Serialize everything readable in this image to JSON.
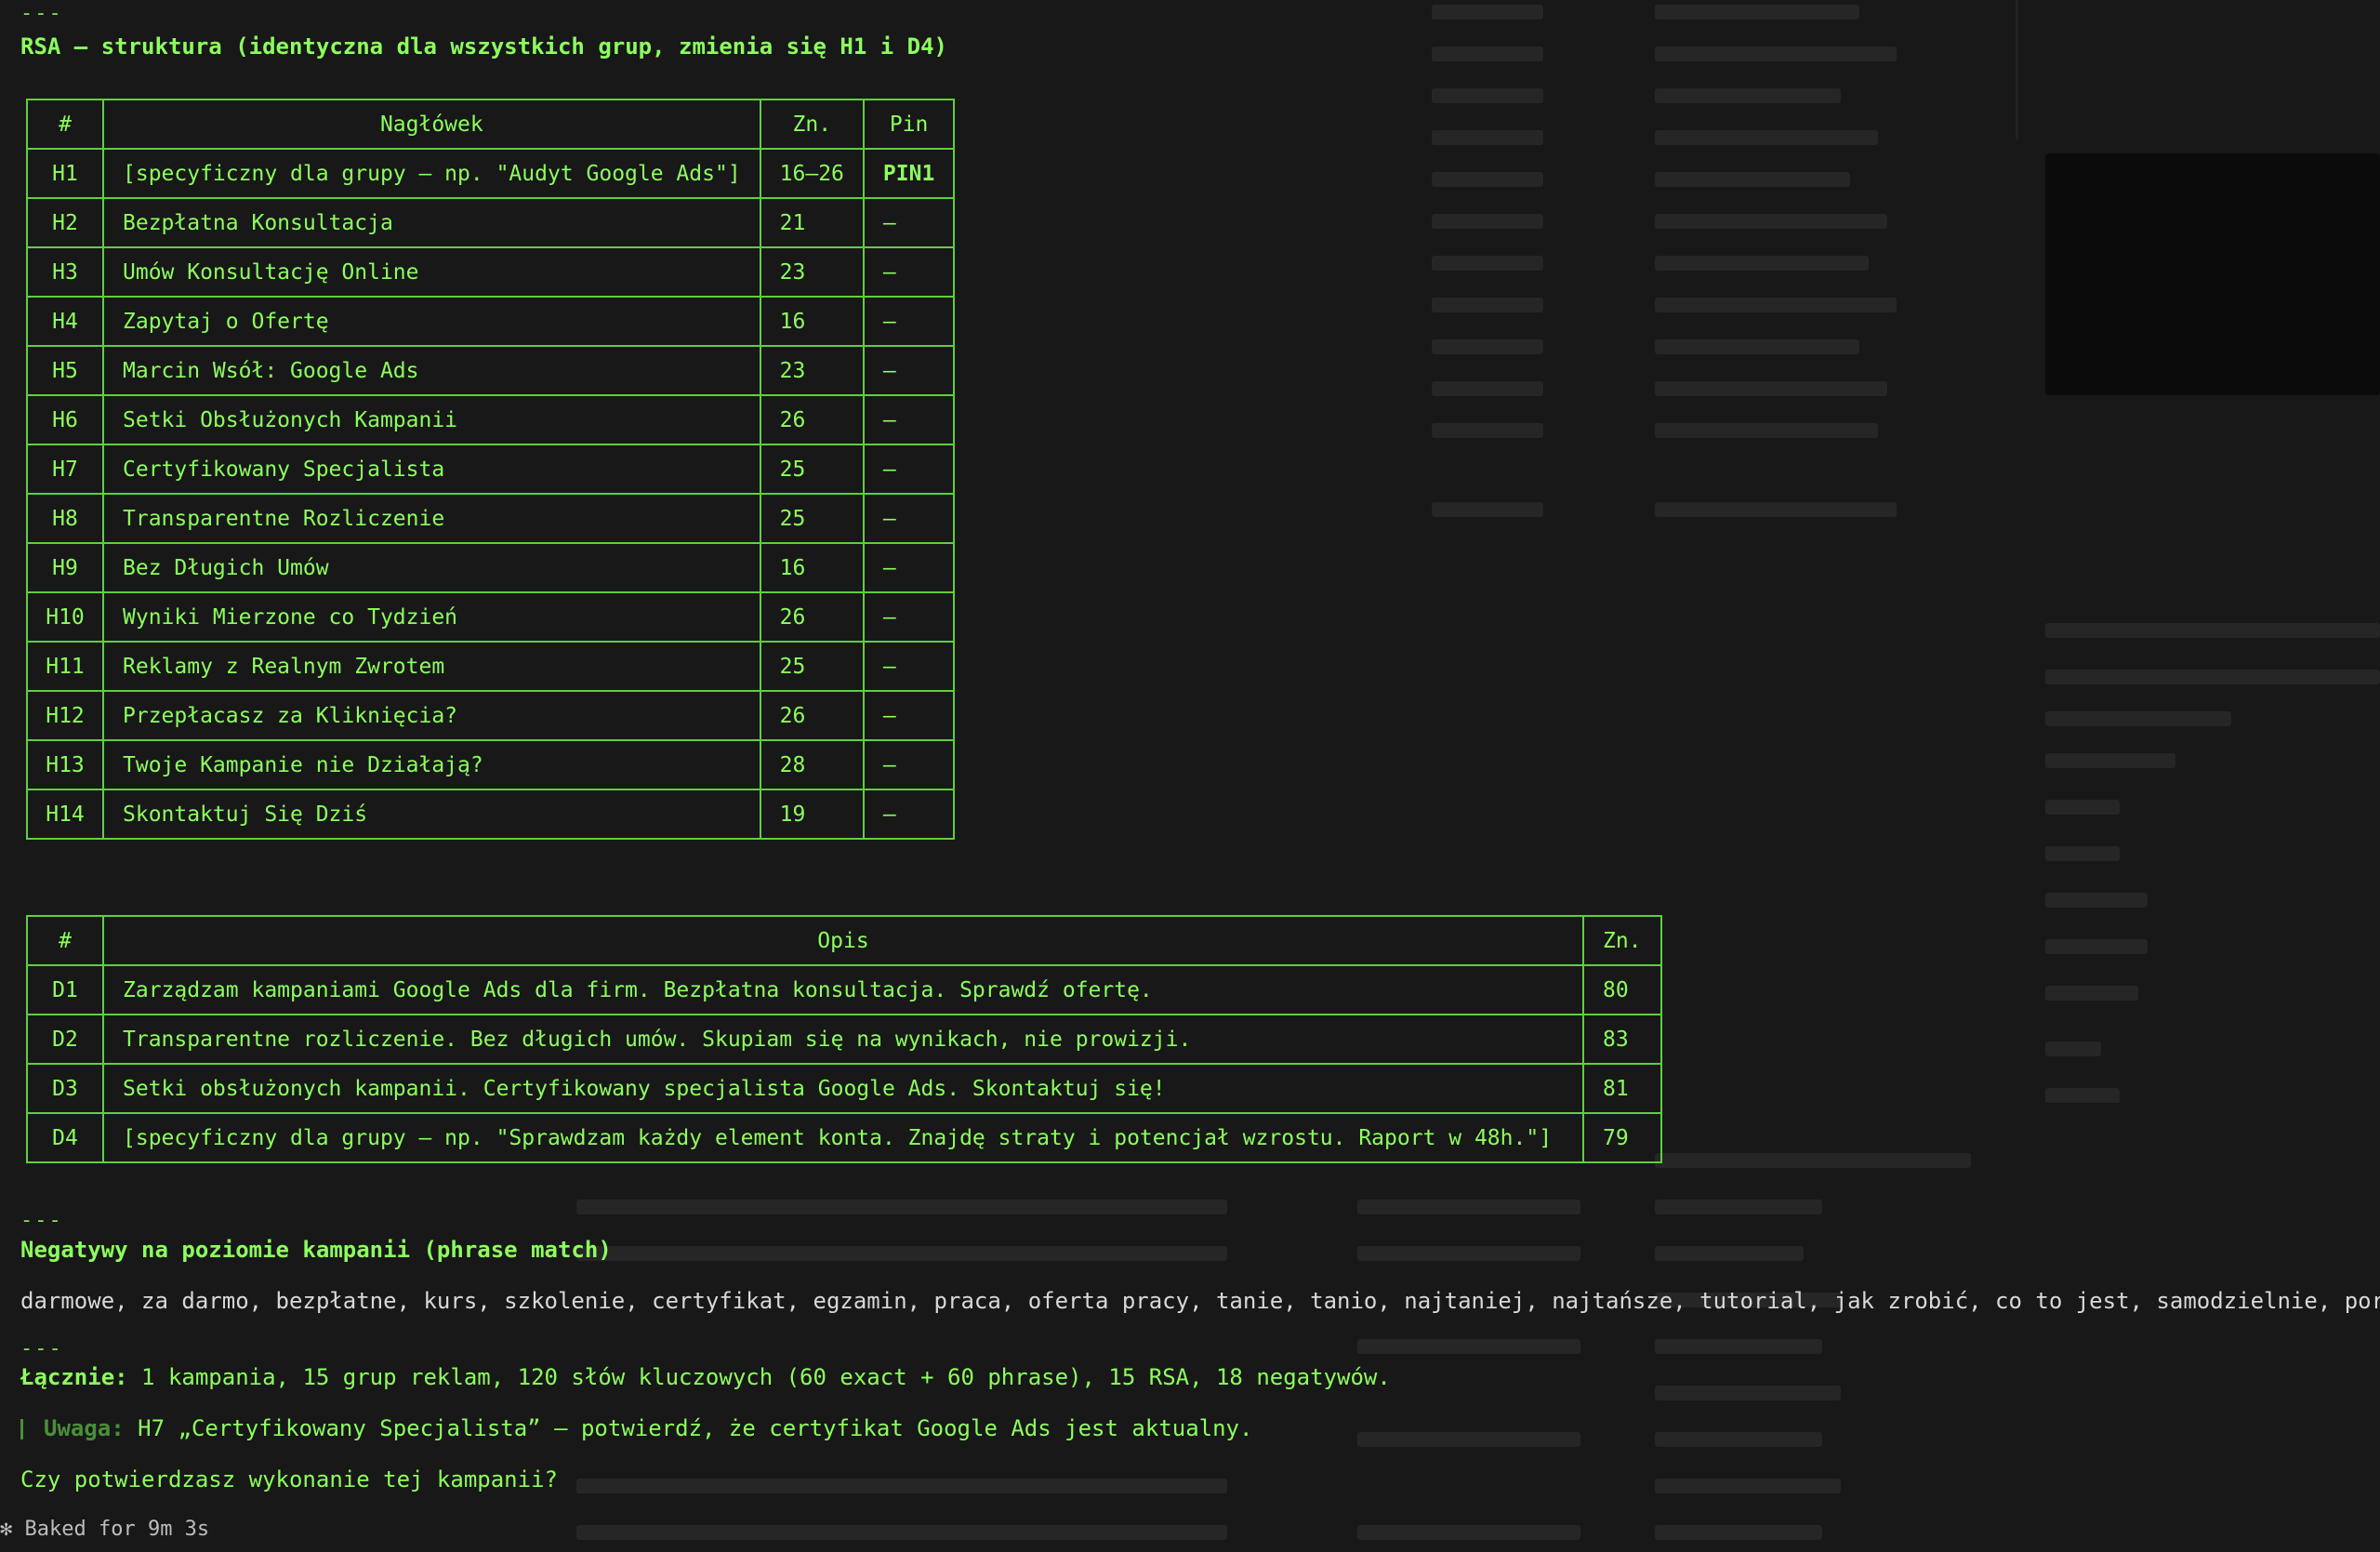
{
  "top_separator": "---",
  "rsa_title": "RSA — struktura (identyczna dla wszystkich grup, zmienia się H1 i D4)",
  "headlines_table": {
    "columns": [
      "#",
      "Nagłówek",
      "Zn.",
      "Pin"
    ],
    "rows": [
      {
        "id": "H1",
        "text": "[specyficzny dla grupy — np. \"Audyt Google Ads\"]",
        "chars": "16–26",
        "pin": "PIN1"
      },
      {
        "id": "H2",
        "text": "Bezpłatna Konsultacja",
        "chars": "21",
        "pin": "—"
      },
      {
        "id": "H3",
        "text": "Umów Konsultację Online",
        "chars": "23",
        "pin": "—"
      },
      {
        "id": "H4",
        "text": "Zapytaj o Ofertę",
        "chars": "16",
        "pin": "—"
      },
      {
        "id": "H5",
        "text": "Marcin Wsół: Google Ads",
        "chars": "23",
        "pin": "—"
      },
      {
        "id": "H6",
        "text": "Setki Obsłużonych Kampanii",
        "chars": "26",
        "pin": "—"
      },
      {
        "id": "H7",
        "text": "Certyfikowany Specjalista",
        "chars": "25",
        "pin": "—"
      },
      {
        "id": "H8",
        "text": "Transparentne Rozliczenie",
        "chars": "25",
        "pin": "—"
      },
      {
        "id": "H9",
        "text": "Bez Długich Umów",
        "chars": "16",
        "pin": "—"
      },
      {
        "id": "H10",
        "text": "Wyniki Mierzone co Tydzień",
        "chars": "26",
        "pin": "—"
      },
      {
        "id": "H11",
        "text": "Reklamy z Realnym Zwrotem",
        "chars": "25",
        "pin": "—"
      },
      {
        "id": "H12",
        "text": "Przepłacasz za Kliknięcia?",
        "chars": "26",
        "pin": "—"
      },
      {
        "id": "H13",
        "text": "Twoje Kampanie nie Działają?",
        "chars": "28",
        "pin": "—"
      },
      {
        "id": "H14",
        "text": "Skontaktuj Się Dziś",
        "chars": "19",
        "pin": "—"
      }
    ]
  },
  "descriptions_table": {
    "columns": [
      "#",
      "Opis",
      "Zn."
    ],
    "rows": [
      {
        "id": "D1",
        "text": "Zarządzam kampaniami Google Ads dla firm. Bezpłatna konsultacja. Sprawdź ofertę.",
        "chars": "80"
      },
      {
        "id": "D2",
        "text": "Transparentne rozliczenie. Bez długich umów. Skupiam się na wynikach, nie prowizji.",
        "chars": "83"
      },
      {
        "id": "D3",
        "text": "Setki obsłużonych kampanii. Certyfikowany specjalista Google Ads. Skontaktuj się!",
        "chars": "81"
      },
      {
        "id": "D4",
        "text": "[specyficzny dla grupy — np. \"Sprawdzam każdy element konta. Znajdę straty i potencjał wzrostu. Raport w 48h.\"]",
        "chars": "79"
      }
    ]
  },
  "negatives_separator": "---",
  "negatives_title": "Negatywy na poziomie kampanii (phrase match)",
  "negatives_list": "darmowe, za darmo, bezpłatne, kurs, szkolenie, certyfikat, egzamin, praca, oferta pracy, tanie, tanio, najtaniej, najtańsze, tutorial, jak zrobić, co to jest, samodzielnie, poradnik",
  "summary_separator": "---",
  "summary_label": "Łącznie:",
  "summary_text": "1 kampania, 15 grup reklam, 120 słów kluczowych (60 exact + 60 phrase), 15 RSA, 18 negatywów.",
  "note_label": "Uwaga:",
  "note_text": "H7 „Certyfikowany Specjalista” — potwierdź, że certyfikat Google Ads jest aktualny.",
  "question": "Czy potwierdzasz wykonanie tej kampanii?",
  "footer_icon": "asterisk-icon",
  "footer_text": "Baked for 9m 3s"
}
